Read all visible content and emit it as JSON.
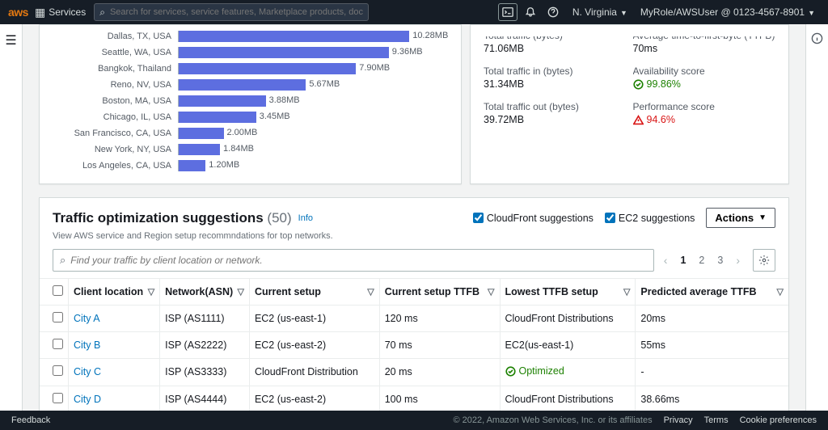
{
  "header": {
    "logo": "aws",
    "services": "Services",
    "search_placeholder": "Search for services, service features, Marketplace products, docs, and more",
    "region": "N. Virginia",
    "role": "MyRole/AWSUser @ 0123-4567-8901"
  },
  "chart_data": {
    "type": "bar",
    "orientation": "horizontal",
    "categories": [
      "Dallas, TX, USA",
      "Seattle, WA, USA",
      "Bangkok, Thailand",
      "Reno, NV, USA",
      "Boston, MA, USA",
      "Chicago, IL, USA",
      "San Francisco, CA, USA",
      "New York, NY, USA",
      "Los Angeles, CA, USA"
    ],
    "values": [
      10.28,
      9.36,
      7.9,
      5.67,
      3.88,
      3.45,
      2.0,
      1.84,
      1.2
    ],
    "value_labels": [
      "10.28MB",
      "9.36MB",
      "7.90MB",
      "5.67MB",
      "3.88MB",
      "3.45MB",
      "2.00MB",
      "1.84MB",
      "1.20MB"
    ],
    "xlim": [
      0,
      12
    ],
    "unit": "MB"
  },
  "kpis": {
    "tt_label": "Total traffic (bytes)",
    "tt_value": "71.06MB",
    "attfb_label": "Average time-to-first-byte (TTFB)",
    "attfb_value": "70ms",
    "tti_label": "Total traffic in (bytes)",
    "tti_value": "31.34MB",
    "avail_label": "Availability score",
    "avail_value": "99.86%",
    "tto_label": "Total traffic out (bytes)",
    "tto_value": "39.72MB",
    "perf_label": "Performance score",
    "perf_value": "94.6%"
  },
  "panel": {
    "title": "Traffic optimization suggestions",
    "count": "(50)",
    "info": "Info",
    "subtitle": "View AWS service and Region setup recommndations for top networks.",
    "cf_label": "CloudFront suggestions",
    "ec2_label": "EC2 suggestions",
    "actions_label": "Actions",
    "filter_placeholder": "Find your traffic by client location or network.",
    "pages": [
      "1",
      "2",
      "3"
    ],
    "columns": {
      "client": "Client location",
      "network": "Network(ASN)",
      "current": "Current setup",
      "current_ttfb": "Current setup TTFB",
      "lowest": "Lowest TTFB setup",
      "predicted": "Predicted average TTFB"
    },
    "rows": [
      {
        "client": "City A",
        "network": "ISP (AS1111)",
        "current": "EC2 (us-east-1)",
        "current_ttfb": "120 ms",
        "lowest": "CloudFront Distributions",
        "lowest_opt": false,
        "predicted": "20ms"
      },
      {
        "client": "City B",
        "network": "ISP (AS2222)",
        "current": "EC2 (us-east-2)",
        "current_ttfb": "70 ms",
        "lowest": "EC2(us-east-1)",
        "lowest_opt": false,
        "predicted": "55ms"
      },
      {
        "client": "City C",
        "network": "ISP (AS3333)",
        "current": "CloudFront Distribution",
        "current_ttfb": "20 ms",
        "lowest": "Optimized",
        "lowest_opt": true,
        "predicted": "-"
      },
      {
        "client": "City D",
        "network": "ISP (AS4444)",
        "current": "EC2 (us-east-2)",
        "current_ttfb": "100 ms",
        "lowest": "CloudFront Distributions",
        "lowest_opt": false,
        "predicted": "38.66ms"
      }
    ]
  },
  "footer": {
    "feedback": "Feedback",
    "copy": "© 2022, Amazon Web Services, Inc. or its affiliates",
    "privacy": "Privacy",
    "terms": "Terms",
    "cookies": "Cookie preferences"
  }
}
